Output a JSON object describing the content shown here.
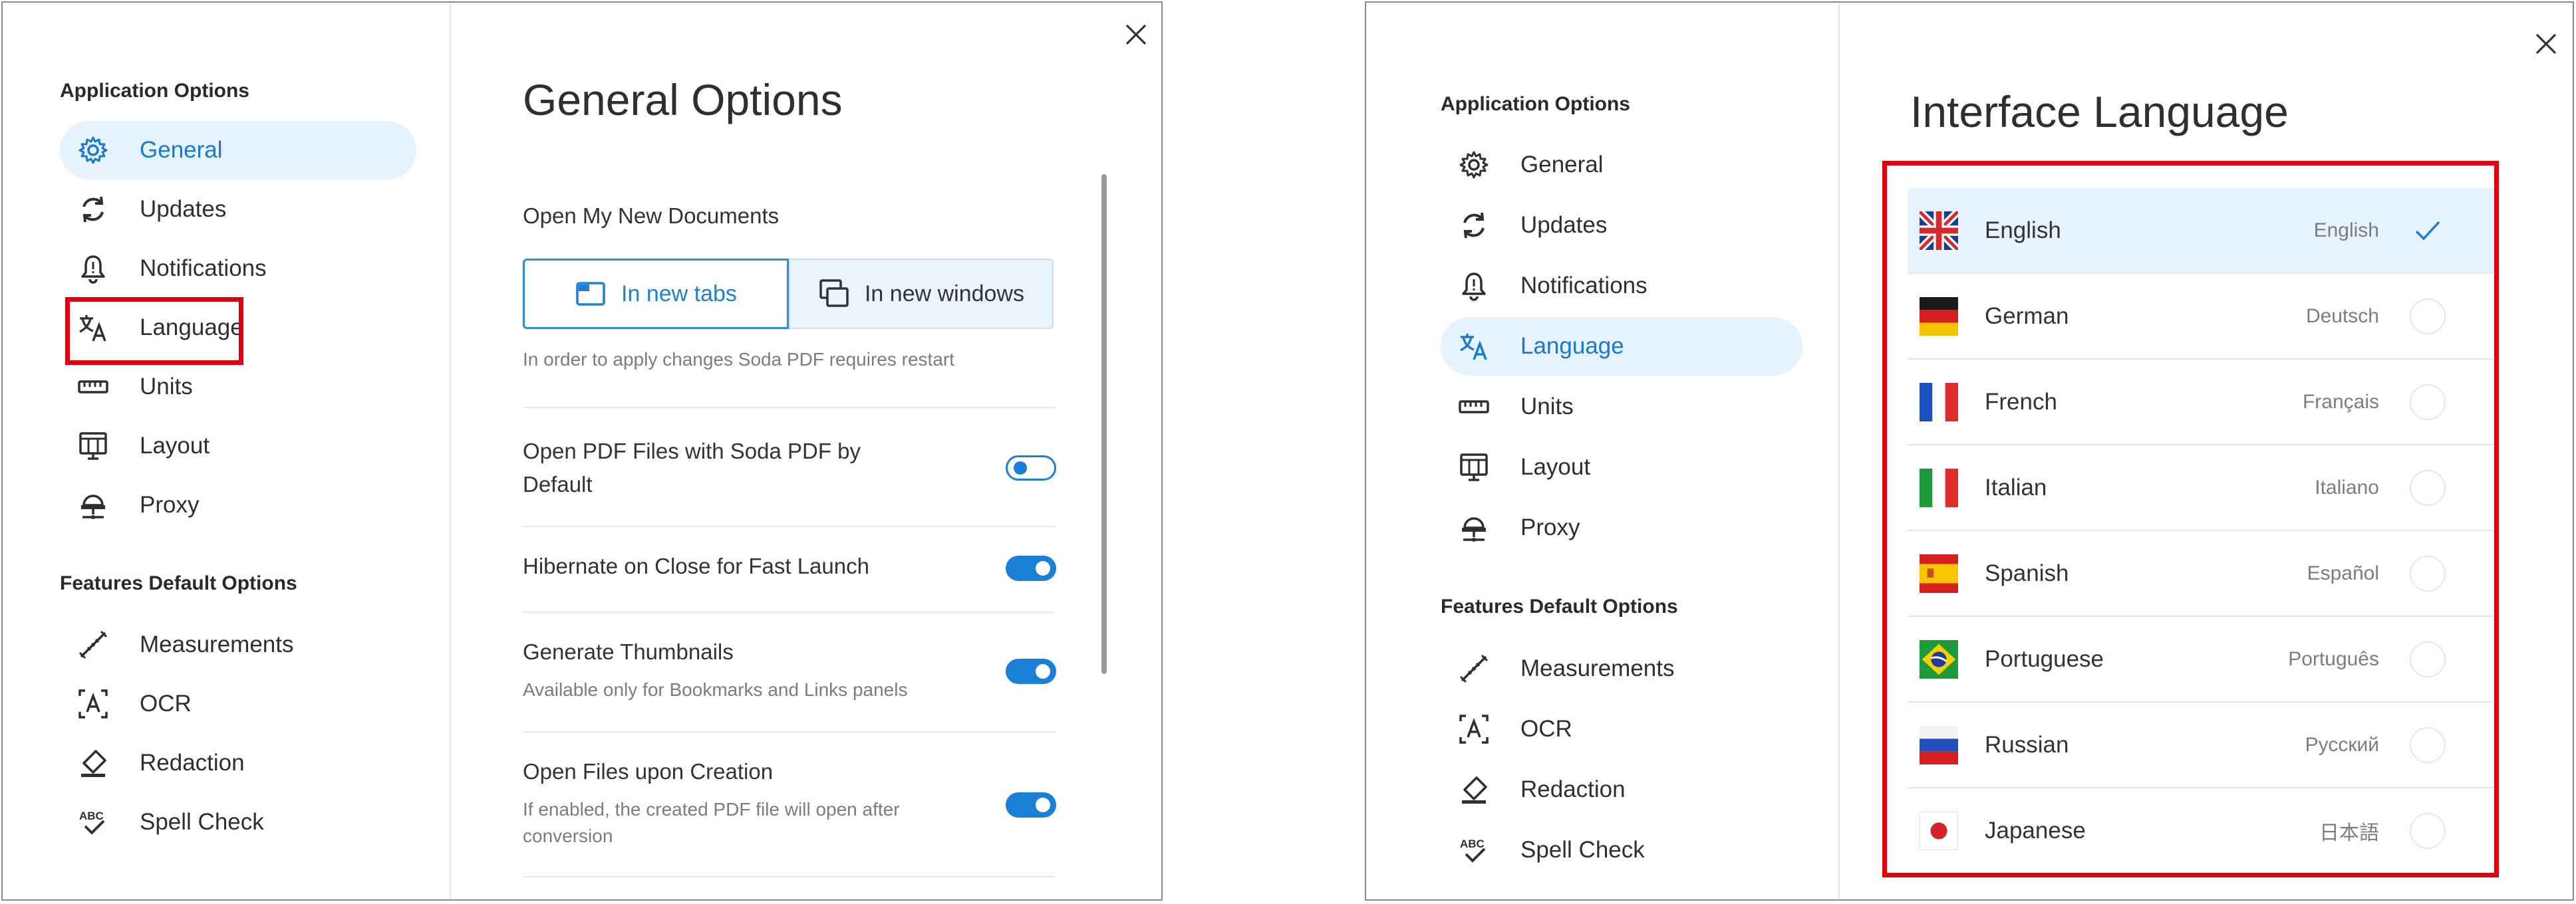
{
  "left_dialog": {
    "sidebar": {
      "app_heading": "Application Options",
      "features_heading": "Features Default Options",
      "app_items": [
        {
          "label": "General",
          "icon": "gear-icon",
          "active": true
        },
        {
          "label": "Updates",
          "icon": "sync-icon",
          "active": false
        },
        {
          "label": "Notifications",
          "icon": "bell-icon",
          "active": false
        },
        {
          "label": "Language",
          "icon": "translate-icon",
          "active": false
        },
        {
          "label": "Units",
          "icon": "ruler-icon",
          "active": false
        },
        {
          "label": "Layout",
          "icon": "layout-icon",
          "active": false
        },
        {
          "label": "Proxy",
          "icon": "proxy-icon",
          "active": false
        }
      ],
      "feature_items": [
        {
          "label": "Measurements",
          "icon": "measure-icon"
        },
        {
          "label": "OCR",
          "icon": "ocr-icon"
        },
        {
          "label": "Redaction",
          "icon": "eraser-icon"
        },
        {
          "label": "Spell Check",
          "icon": "spellcheck-icon"
        }
      ]
    },
    "main": {
      "title": "General Options",
      "open_docs_label": "Open My New Documents",
      "tabs_option": "In new tabs",
      "windows_option": "In new windows",
      "restart_note": "In order to apply changes Soda PDF requires restart",
      "options": [
        {
          "label": "Open PDF Files with Soda PDF by Default",
          "sub": "",
          "on": false
        },
        {
          "label": "Hibernate on Close for Fast Launch",
          "sub": "",
          "on": true
        },
        {
          "label": "Generate Thumbnails",
          "sub": "Available only for Bookmarks and Links panels",
          "on": true
        },
        {
          "label": "Open Files upon Creation",
          "sub": "If enabled, the created PDF file will open after conversion",
          "on": true
        }
      ]
    }
  },
  "right_dialog": {
    "sidebar": {
      "app_heading": "Application Options",
      "features_heading": "Features Default Options",
      "app_items": [
        {
          "label": "General",
          "icon": "gear-icon",
          "active": false
        },
        {
          "label": "Updates",
          "icon": "sync-icon",
          "active": false
        },
        {
          "label": "Notifications",
          "icon": "bell-icon",
          "active": false
        },
        {
          "label": "Language",
          "icon": "translate-icon",
          "active": true
        },
        {
          "label": "Units",
          "icon": "ruler-icon",
          "active": false
        },
        {
          "label": "Layout",
          "icon": "layout-icon",
          "active": false
        },
        {
          "label": "Proxy",
          "icon": "proxy-icon",
          "active": false
        }
      ],
      "feature_items": [
        {
          "label": "Measurements",
          "icon": "measure-icon"
        },
        {
          "label": "OCR",
          "icon": "ocr-icon"
        },
        {
          "label": "Redaction",
          "icon": "eraser-icon"
        },
        {
          "label": "Spell Check",
          "icon": "spellcheck-icon"
        }
      ]
    },
    "main": {
      "title": "Interface Language",
      "languages": [
        {
          "name": "English",
          "native": "English",
          "flag": "uk-flag-icon",
          "selected": true
        },
        {
          "name": "German",
          "native": "Deutsch",
          "flag": "germany-flag-icon",
          "selected": false
        },
        {
          "name": "French",
          "native": "Français",
          "flag": "france-flag-icon",
          "selected": false
        },
        {
          "name": "Italian",
          "native": "Italiano",
          "flag": "italy-flag-icon",
          "selected": false
        },
        {
          "name": "Spanish",
          "native": "Español",
          "flag": "spain-flag-icon",
          "selected": false
        },
        {
          "name": "Portuguese",
          "native": "Português",
          "flag": "brazil-flag-icon",
          "selected": false
        },
        {
          "name": "Russian",
          "native": "Русский",
          "flag": "russia-flag-icon",
          "selected": false
        },
        {
          "name": "Japanese",
          "native": "日本語",
          "flag": "japan-flag-icon",
          "selected": false
        }
      ]
    }
  },
  "colors": {
    "accent": "#1a7fd6",
    "active_bg": "#e6f2fc",
    "highlight": "#e0000f"
  }
}
